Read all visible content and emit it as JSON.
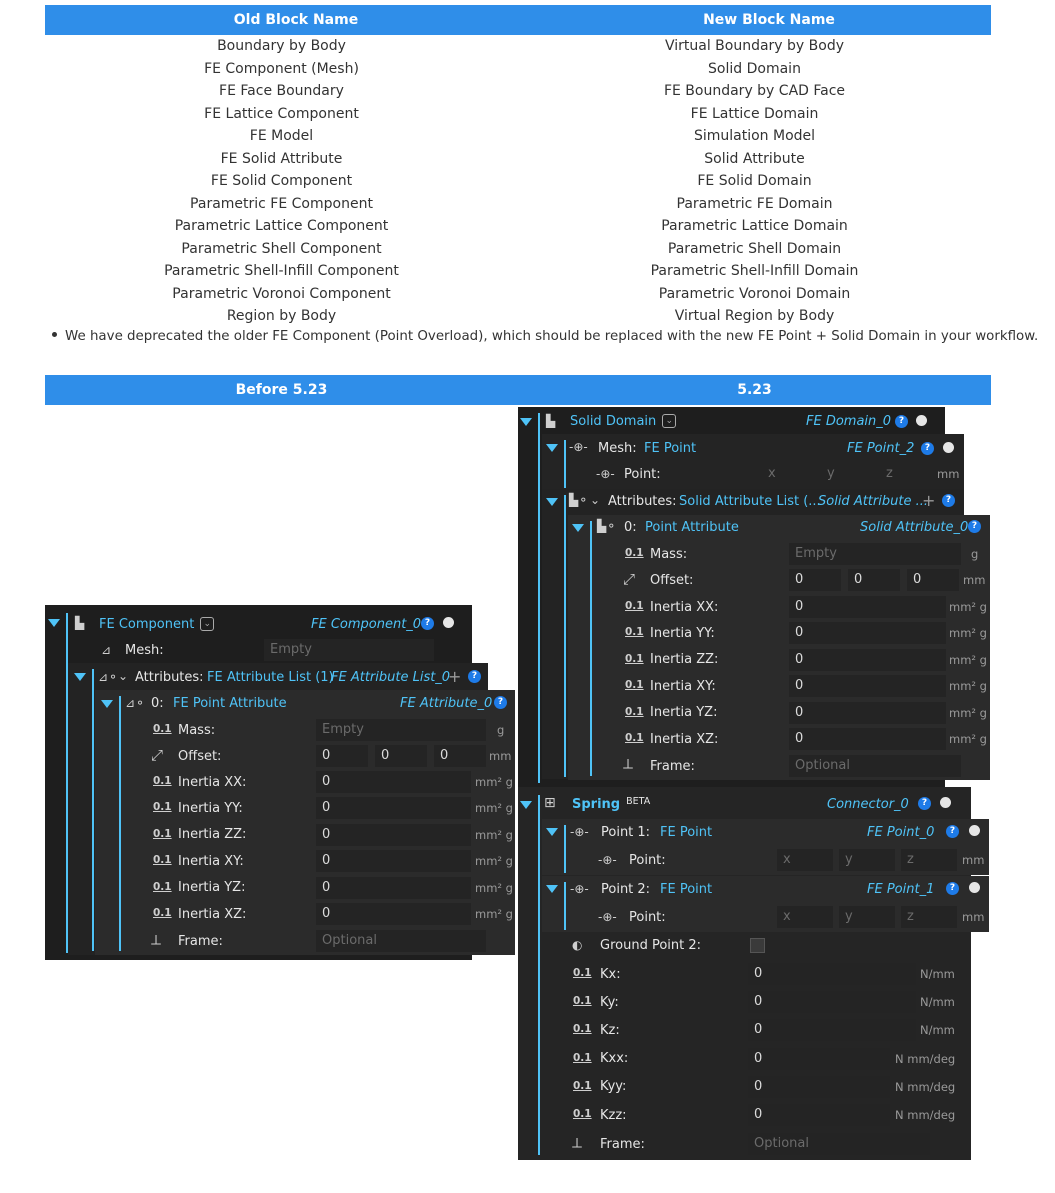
{
  "table": {
    "header_old": "Old Block Name",
    "header_new": "New Block Name",
    "rows": [
      [
        "Boundary by Body",
        "Virtual Boundary by Body"
      ],
      [
        "FE Component (Mesh)",
        "Solid Domain"
      ],
      [
        "FE Face Boundary",
        "FE Boundary by CAD Face"
      ],
      [
        "FE Lattice Component",
        "FE Lattice Domain"
      ],
      [
        "FE Model",
        "Simulation Model"
      ],
      [
        "FE Solid Attribute",
        "Solid Attribute"
      ],
      [
        "FE Solid Component",
        "FE Solid Domain"
      ],
      [
        "Parametric FE Component",
        "Parametric FE Domain"
      ],
      [
        "Parametric Lattice Component",
        "Parametric Lattice Domain"
      ],
      [
        "Parametric Shell Component",
        "Parametric Shell Domain"
      ],
      [
        "Parametric Shell-Infill Component",
        "Parametric Shell-Infill Domain"
      ],
      [
        "Parametric Voronoi Component",
        "Parametric Voronoi Domain"
      ],
      [
        "Region by Body",
        "Virtual Region by Body"
      ]
    ]
  },
  "note": "We have deprecated the older FE Component (Point Overload), which should be replaced with the new FE Point + Solid Domain in your workflow.",
  "compare": {
    "before": "Before 5.23",
    "after": "5.23"
  },
  "colors": {
    "header_bg": "#2f8ee9",
    "accent": "#4fc3f7",
    "panel_bg": "#1e1e1e"
  },
  "before": {
    "title": "FE Component",
    "id": "FE Component_0",
    "mesh_label": "Mesh:",
    "mesh_value": "Empty",
    "attr_label": "Attributes:",
    "attr_value": "FE Attribute List (1)",
    "attr_id": "FE Attribute List_0",
    "item_label": "0:",
    "item_value": "FE Point Attribute",
    "item_id": "FE Attribute_0",
    "mass_label": "Mass:",
    "mass_value": "Empty",
    "mass_unit": "g",
    "offset_label": "Offset:",
    "offset_x": "0",
    "offset_y": "0",
    "offset_z": "0",
    "offset_unit": "mm",
    "inertia": [
      {
        "label": "Inertia XX:",
        "value": "0",
        "unit": "mm² g"
      },
      {
        "label": "Inertia YY:",
        "value": "0",
        "unit": "mm² g"
      },
      {
        "label": "Inertia ZZ:",
        "value": "0",
        "unit": "mm² g"
      },
      {
        "label": "Inertia XY:",
        "value": "0",
        "unit": "mm² g"
      },
      {
        "label": "Inertia YZ:",
        "value": "0",
        "unit": "mm² g"
      },
      {
        "label": "Inertia XZ:",
        "value": "0",
        "unit": "mm² g"
      }
    ],
    "frame_label": "Frame:",
    "frame_value": "Optional",
    "num_icon": "0.1"
  },
  "after": {
    "title": "Solid Domain",
    "id": "FE Domain_0",
    "mesh_label": "Mesh:",
    "mesh_value": "FE Point",
    "mesh_id": "FE Point_2",
    "point_label": "Point:",
    "px": "x",
    "py": "y",
    "pz": "z",
    "point_unit": "mm",
    "attr_label": "Attributes:",
    "attr_value": "Solid Attribute List (...",
    "attr_id": "Solid Attribute ...",
    "item_label": "0:",
    "item_value": "Point Attribute",
    "item_id": "Solid Attribute_0",
    "mass_label": "Mass:",
    "mass_value": "Empty",
    "mass_unit": "g",
    "offset_label": "Offset:",
    "offset_x": "0",
    "offset_y": "0",
    "offset_z": "0",
    "offset_unit": "mm",
    "inertia": [
      {
        "label": "Inertia XX:",
        "value": "0",
        "unit": "mm² g"
      },
      {
        "label": "Inertia YY:",
        "value": "0",
        "unit": "mm² g"
      },
      {
        "label": "Inertia ZZ:",
        "value": "0",
        "unit": "mm² g"
      },
      {
        "label": "Inertia XY:",
        "value": "0",
        "unit": "mm² g"
      },
      {
        "label": "Inertia YZ:",
        "value": "0",
        "unit": "mm² g"
      },
      {
        "label": "Inertia XZ:",
        "value": "0",
        "unit": "mm² g"
      }
    ],
    "frame_label": "Frame:",
    "frame_value": "Optional",
    "num_icon": "0.1"
  },
  "spring": {
    "title": "Spring",
    "beta": "BETA",
    "id": "Connector_0",
    "p1_label": "Point 1:",
    "p1_value": "FE Point",
    "p1_id": "FE Point_0",
    "p2_label": "Point 2:",
    "p2_value": "FE Point",
    "p2_id": "FE Point_1",
    "point_label": "Point:",
    "px": "x",
    "py": "y",
    "pz": "z",
    "point_unit": "mm",
    "ground_label": "Ground Point 2:",
    "stiff": [
      {
        "label": "Kx:",
        "value": "0",
        "unit": "N/mm"
      },
      {
        "label": "Ky:",
        "value": "0",
        "unit": "N/mm"
      },
      {
        "label": "Kz:",
        "value": "0",
        "unit": "N/mm"
      },
      {
        "label": "Kxx:",
        "value": "0",
        "unit": "N mm/deg"
      },
      {
        "label": "Kyy:",
        "value": "0",
        "unit": "N mm/deg"
      },
      {
        "label": "Kzz:",
        "value": "0",
        "unit": "N mm/deg"
      }
    ],
    "frame_label": "Frame:",
    "frame_value": "Optional",
    "num_icon": "0.1",
    "help": "?"
  }
}
